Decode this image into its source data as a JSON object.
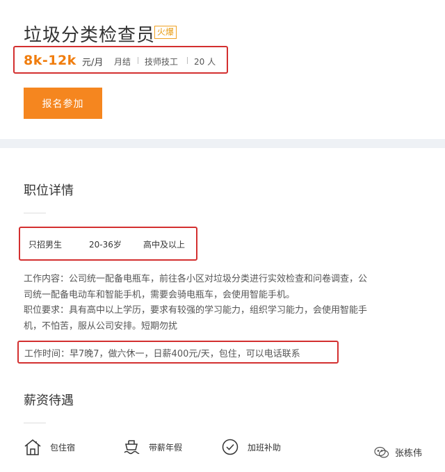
{
  "job": {
    "title": "垃圾分类检查员",
    "hot_badge": "火爆",
    "salary": "8k-12k",
    "salary_unit": "元/月",
    "meta": [
      "月结",
      "技师技工",
      "20 人"
    ],
    "signup_label": "报名参加"
  },
  "details": {
    "section_title": "职位详情",
    "requirements": [
      "只招男生",
      "20-36岁",
      "高中及以上"
    ],
    "description_lines": [
      "工作内容：公司统一配备电瓶车，前往各小区对垃圾分类进行实效检查和问卷调查，公",
      "司统一配备电动车和智能手机，需要会骑电瓶车，会使用智能手机。",
      "职位要求：具有高中以上学历，要求有较强的学习能力，组织学习能力，会使用智能手",
      "机，不怕苦，服从公司安排。短期勿扰"
    ],
    "work_time": "工作时间：早7晚7，做六休一，日薪400元/天，包住，可以电话联系"
  },
  "benefits": {
    "section_title": "薪资待遇",
    "items": [
      {
        "label": "包住宿",
        "icon": "house-icon"
      },
      {
        "label": "带薪年假",
        "icon": "ship-icon"
      },
      {
        "label": "加班补助",
        "icon": "clock-check-icon"
      }
    ]
  },
  "watermark": {
    "text": "张栋伟",
    "icon": "wechat-icon"
  },
  "colors": {
    "accent": "#f5861f",
    "salary": "#f07d0e",
    "highlight_border": "#d32f2f",
    "hot_badge": "#e89b10"
  }
}
